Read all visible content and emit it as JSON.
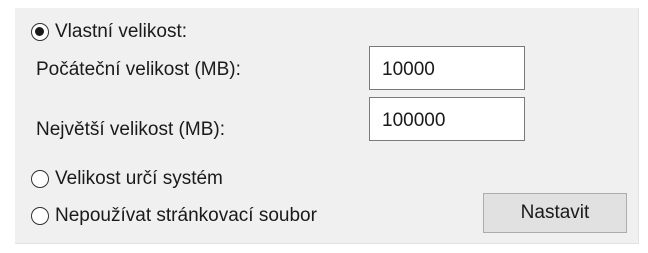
{
  "options": {
    "custom_size": {
      "label": "Vlastní velikost:",
      "selected": true
    },
    "system_managed": {
      "label": "Velikost určí systém",
      "selected": false
    },
    "no_paging_file": {
      "label": "Nepoužívat stránkovací soubor",
      "selected": false
    }
  },
  "fields": {
    "initial_size": {
      "label": "Počáteční velikost (MB):",
      "value": "10000"
    },
    "maximum_size": {
      "label": "Největší velikost (MB):",
      "value": "100000"
    }
  },
  "buttons": {
    "set_label": "Nastavit"
  }
}
